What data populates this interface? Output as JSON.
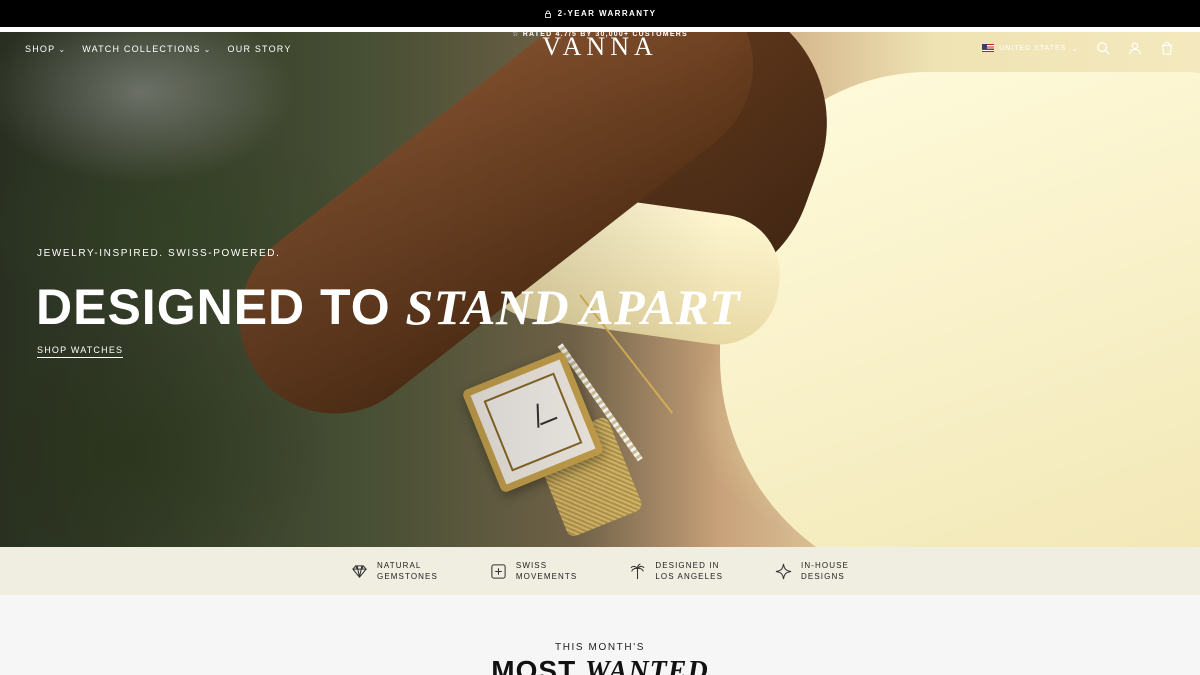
{
  "announcement": {
    "text": "2-YEAR WARRANTY",
    "icon": "lock-icon"
  },
  "header": {
    "rating_text": "☆ RATED 4.7/5 BY 30,000+ CUSTOMERS",
    "logo": "VANNA",
    "nav": [
      {
        "label": "SHOP",
        "has_dropdown": true
      },
      {
        "label": "WATCH COLLECTIONS",
        "has_dropdown": true
      },
      {
        "label": "OUR STORY",
        "has_dropdown": false
      }
    ],
    "country": "UNITED STATES",
    "icons": [
      "search-icon",
      "account-icon",
      "cart-icon"
    ]
  },
  "hero": {
    "eyebrow": "JEWELRY-INSPIRED. SWISS-POWERED.",
    "headline_plain": "DESIGNED TO",
    "headline_italic": "STAND APART",
    "cta": "SHOP WATCHES"
  },
  "features": [
    {
      "icon": "diamond-icon",
      "line1": "NATURAL",
      "line2": "GEMSTONES"
    },
    {
      "icon": "swiss-cross-icon",
      "line1": "SWISS",
      "line2": "MOVEMENTS"
    },
    {
      "icon": "palm-tree-icon",
      "line1": "DESIGNED IN",
      "line2": "LOS ANGELES"
    },
    {
      "icon": "sparkle-icon",
      "line1": "IN-HOUSE",
      "line2": "DESIGNS"
    }
  ],
  "most_wanted": {
    "eyebrow": "THIS MONTH'S",
    "title_plain": "MOST",
    "title_italic": "WANTED"
  }
}
